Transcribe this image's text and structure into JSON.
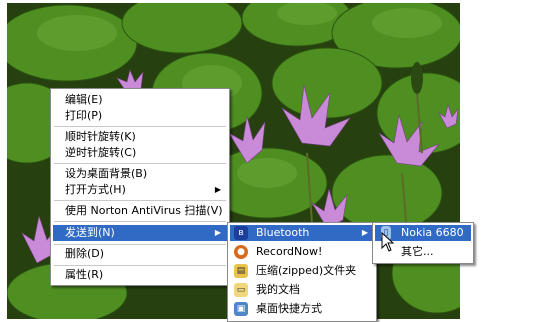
{
  "context_menu": {
    "items": [
      {
        "label": "编辑(E)"
      },
      {
        "label": "打印(P)"
      },
      {
        "label": "顺时针旋转(K)"
      },
      {
        "label": "逆时针旋转(C)"
      },
      {
        "label": "设为桌面背景(B)"
      },
      {
        "label": "打开方式(H)"
      },
      {
        "label": "使用 Norton AntiVirus 扫描(V)"
      },
      {
        "label": "发送到(N)"
      },
      {
        "label": "删除(D)"
      },
      {
        "label": "属性(R)"
      }
    ]
  },
  "sendto_menu": {
    "items": [
      {
        "label": "Bluetooth",
        "icon": "bluetooth-icon"
      },
      {
        "label": "RecordNow!",
        "icon": "recordnow-icon"
      },
      {
        "label": "压缩(zipped)文件夹",
        "icon": "zip-folder-icon"
      },
      {
        "label": "我的文档",
        "icon": "my-documents-icon"
      },
      {
        "label": "桌面快捷方式",
        "icon": "desktop-shortcut-icon"
      }
    ]
  },
  "bluetooth_menu": {
    "items": [
      {
        "label": "Nokia 6680",
        "icon": "phone-icon"
      },
      {
        "label": "其它..."
      }
    ]
  },
  "colors": {
    "highlight": "#316ac5",
    "lotus": "#c98ad8",
    "leaf": "#3f7a1c"
  }
}
